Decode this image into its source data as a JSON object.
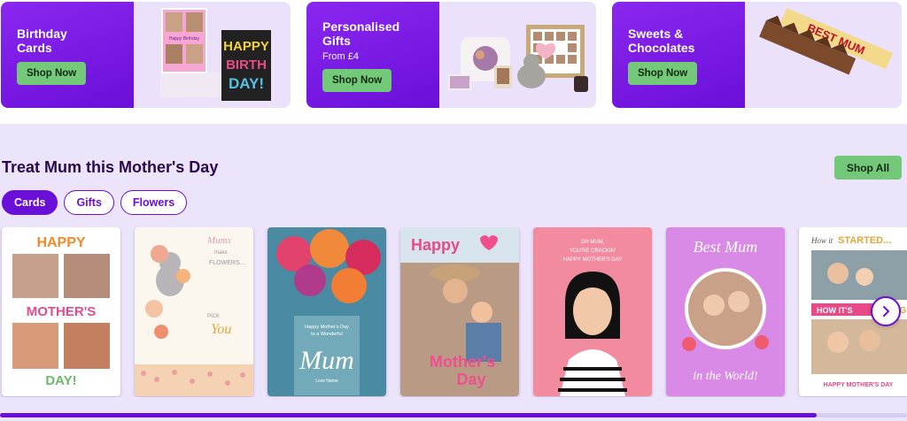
{
  "promos": [
    {
      "title_line1": "Birthday",
      "title_line2": "Cards",
      "sub": "",
      "button": "Shop Now"
    },
    {
      "title_line1": "Personalised",
      "title_line2": "Gifts",
      "sub": "From £4",
      "button": "Shop Now"
    },
    {
      "title_line1": "Sweets &",
      "title_line2": "Chocolates",
      "sub": "",
      "button": "Shop Now"
    }
  ],
  "promo_art_text": {
    "birthday_card": [
      "HAPPY",
      "BIRTH",
      "DAY!"
    ],
    "birthday_card_small": "Happy Birthday",
    "chocolate_label": "BEST MUM"
  },
  "section": {
    "title": "Treat Mum this Mother's Day",
    "shop_all": "Shop All",
    "tabs": [
      "Cards",
      "Gifts",
      "Flowers"
    ],
    "active_tab": "Cards"
  },
  "cards": [
    {
      "lines": [
        "HAPPY",
        "MOTHER'S",
        "DAY!"
      ]
    },
    {
      "lines": [
        "Mums",
        "make",
        "FLOWERS...",
        "PICK",
        "You"
      ]
    },
    {
      "lines": [
        "Happy Mother's Day",
        "to a Wonderful",
        "Mum",
        "Love Name"
      ]
    },
    {
      "lines": [
        "Happy",
        "Mother's",
        "Day"
      ]
    },
    {
      "lines": [
        "OH MUM,",
        "YOU'RE CRACKIN'",
        "HAPPY MOTHER'S DAY"
      ]
    },
    {
      "lines": [
        "Best Mum",
        "in the World!"
      ]
    },
    {
      "lines": [
        "How it",
        "STARTED...",
        "HOW IT'S",
        "GOING",
        "HAPPY MOTHER'S DAY"
      ]
    }
  ],
  "carousel": {
    "scroll_progress": 0.9
  },
  "colors": {
    "brand_purple": "#6a0fd8",
    "cta_green": "#74c87a",
    "section_bg": "#ebe4fb"
  }
}
